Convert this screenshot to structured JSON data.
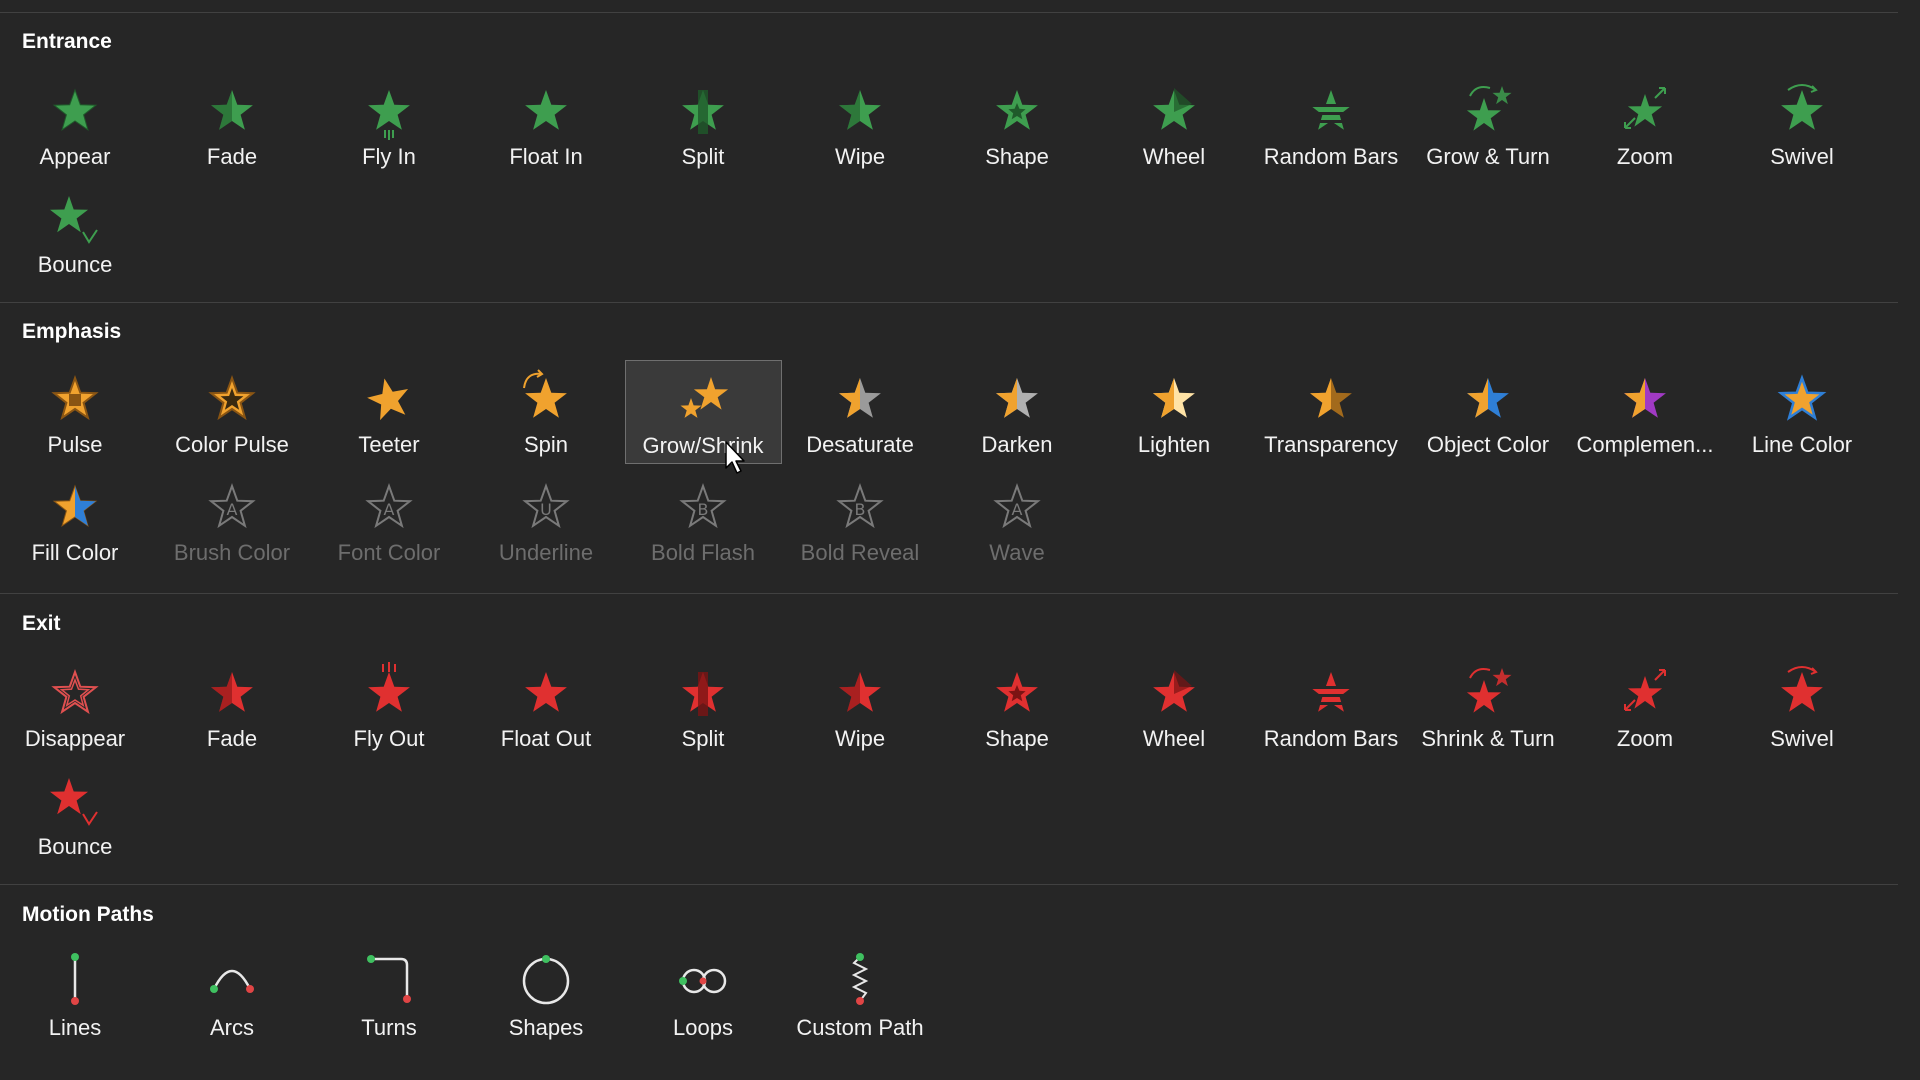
{
  "colors": {
    "background": "#262626",
    "divider": "#414141",
    "entrance": "#3e9e4f",
    "emphasis": "#f0a22e",
    "exit": "#e03030",
    "disabled": "#6d6d6d"
  },
  "sections": [
    {
      "title": "Entrance",
      "kind": "entrance",
      "items": [
        {
          "label": "Appear",
          "icon": "star-appear-icon"
        },
        {
          "label": "Fade",
          "icon": "star-fade-icon"
        },
        {
          "label": "Fly In",
          "icon": "star-fly-in-icon"
        },
        {
          "label": "Float In",
          "icon": "star-float-in-icon"
        },
        {
          "label": "Split",
          "icon": "star-split-icon"
        },
        {
          "label": "Wipe",
          "icon": "star-wipe-icon"
        },
        {
          "label": "Shape",
          "icon": "star-shape-icon"
        },
        {
          "label": "Wheel",
          "icon": "star-wheel-icon"
        },
        {
          "label": "Random Bars",
          "icon": "star-random-bars-icon"
        },
        {
          "label": "Grow & Turn",
          "icon": "star-grow-turn-icon"
        },
        {
          "label": "Zoom",
          "icon": "star-zoom-icon"
        },
        {
          "label": "Swivel",
          "icon": "star-swivel-icon"
        },
        {
          "label": "Bounce",
          "icon": "star-bounce-icon"
        }
      ]
    },
    {
      "title": "Emphasis",
      "kind": "emphasis",
      "items": [
        {
          "label": "Pulse",
          "icon": "star-pulse-icon"
        },
        {
          "label": "Color Pulse",
          "icon": "star-color-pulse-icon"
        },
        {
          "label": "Teeter",
          "icon": "star-teeter-icon"
        },
        {
          "label": "Spin",
          "icon": "star-spin-icon"
        },
        {
          "label": "Grow/Shrink",
          "icon": "star-grow-shrink-icon",
          "selected": true
        },
        {
          "label": "Desaturate",
          "icon": "star-desaturate-icon"
        },
        {
          "label": "Darken",
          "icon": "star-darken-icon"
        },
        {
          "label": "Lighten",
          "icon": "star-lighten-icon"
        },
        {
          "label": "Transparency",
          "icon": "star-transparency-icon"
        },
        {
          "label": "Object Color",
          "icon": "star-object-color-icon"
        },
        {
          "label": "Complemen...",
          "icon": "star-complementary-color-icon"
        },
        {
          "label": "Line Color",
          "icon": "star-line-color-icon"
        },
        {
          "label": "Fill Color",
          "icon": "star-fill-color-icon"
        },
        {
          "label": "Brush Color",
          "icon": "star-brush-color-icon",
          "disabled": true
        },
        {
          "label": "Font Color",
          "icon": "star-font-color-icon",
          "disabled": true
        },
        {
          "label": "Underline",
          "icon": "star-underline-icon",
          "disabled": true
        },
        {
          "label": "Bold Flash",
          "icon": "star-bold-flash-icon",
          "disabled": true
        },
        {
          "label": "Bold Reveal",
          "icon": "star-bold-reveal-icon",
          "disabled": true
        },
        {
          "label": "Wave",
          "icon": "star-wave-icon",
          "disabled": true
        }
      ]
    },
    {
      "title": "Exit",
      "kind": "exit",
      "items": [
        {
          "label": "Disappear",
          "icon": "star-disappear-icon"
        },
        {
          "label": "Fade",
          "icon": "star-fade-icon"
        },
        {
          "label": "Fly Out",
          "icon": "star-fly-out-icon"
        },
        {
          "label": "Float Out",
          "icon": "star-float-out-icon"
        },
        {
          "label": "Split",
          "icon": "star-split-icon"
        },
        {
          "label": "Wipe",
          "icon": "star-wipe-icon"
        },
        {
          "label": "Shape",
          "icon": "star-shape-icon"
        },
        {
          "label": "Wheel",
          "icon": "star-wheel-icon"
        },
        {
          "label": "Random Bars",
          "icon": "star-random-bars-icon"
        },
        {
          "label": "Shrink & Turn",
          "icon": "star-shrink-turn-icon"
        },
        {
          "label": "Zoom",
          "icon": "star-zoom-icon"
        },
        {
          "label": "Swivel",
          "icon": "star-swivel-icon"
        },
        {
          "label": "Bounce",
          "icon": "star-bounce-icon"
        }
      ]
    },
    {
      "title": "Motion Paths",
      "kind": "motion",
      "items": [
        {
          "label": "Lines",
          "icon": "motion-lines-icon"
        },
        {
          "label": "Arcs",
          "icon": "motion-arcs-icon"
        },
        {
          "label": "Turns",
          "icon": "motion-turns-icon"
        },
        {
          "label": "Shapes",
          "icon": "motion-shapes-icon"
        },
        {
          "label": "Loops",
          "icon": "motion-loops-icon"
        },
        {
          "label": "Custom Path",
          "icon": "motion-custom-path-icon"
        }
      ]
    }
  ]
}
